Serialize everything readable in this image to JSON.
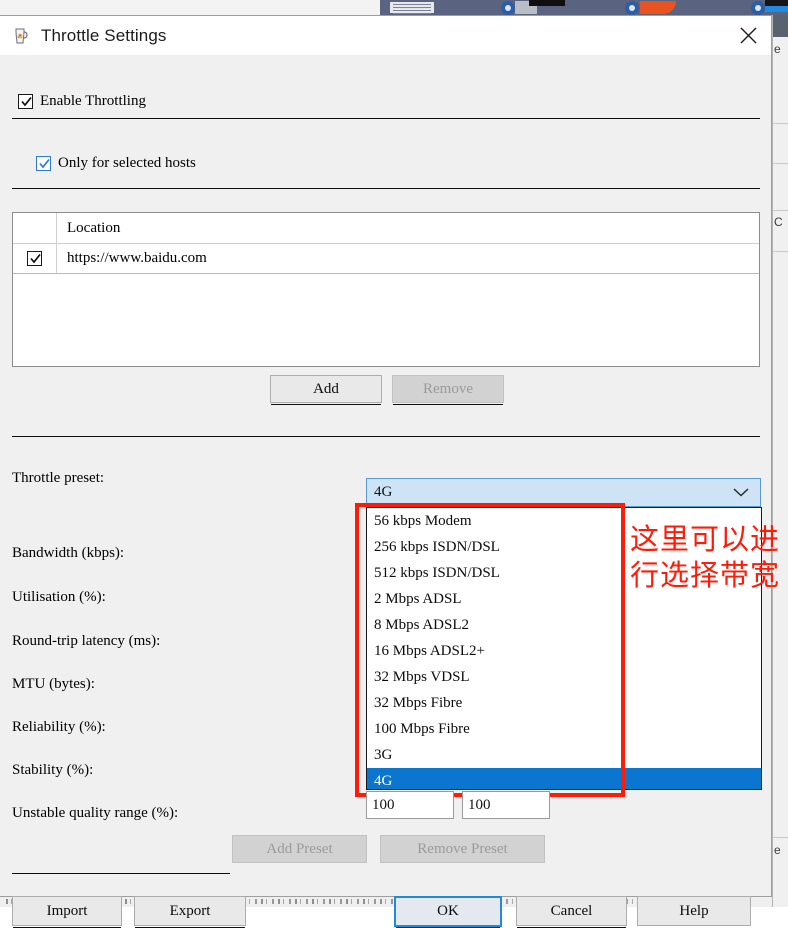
{
  "window": {
    "title": "Throttle Settings",
    "app_icon": "jug-icon",
    "close_label": "✕"
  },
  "options": {
    "enable_throttling": {
      "label": "Enable Throttling",
      "checked": true
    },
    "only_selected_hosts": {
      "label": "Only for selected hosts",
      "checked": true
    }
  },
  "host_table": {
    "column_header": "Location",
    "rows": [
      {
        "checked": true,
        "location": "https://www.baidu.com"
      }
    ],
    "add_label": "Add",
    "remove_label": "Remove",
    "remove_enabled": false
  },
  "fields": {
    "throttle_preset_label": "Throttle preset:",
    "bandwidth_label": "Bandwidth (kbps):",
    "utilisation_label": "Utilisation (%):",
    "latency_label": "Round-trip latency (ms):",
    "mtu_label": "MTU (bytes):",
    "reliability_label": "Reliability (%):",
    "stability_label": "Stability (%):",
    "unstable_range_label": "Unstable quality range (%):",
    "unstable_range_min": "100",
    "unstable_range_max": "100"
  },
  "preset_combo": {
    "selected": "4G",
    "chevron": "chevron-down-icon",
    "expanded": true,
    "options": [
      "56 kbps Modem",
      "256 kbps ISDN/DSL",
      "512 kbps ISDN/DSL",
      "2 Mbps ADSL",
      "8 Mbps ADSL2",
      "16 Mbps ADSL2+",
      "32 Mbps VDSL",
      "32 Mbps Fibre",
      "100 Mbps Fibre",
      "3G",
      "4G"
    ],
    "selected_index": 10
  },
  "preset_buttons": {
    "add_preset_label": "Add Preset",
    "remove_preset_label": "Remove Preset",
    "add_preset_enabled": false,
    "remove_preset_enabled": false
  },
  "footer": {
    "import_label": "Import",
    "export_label": "Export",
    "ok_label": "OK",
    "cancel_label": "Cancel",
    "help_label": "Help"
  },
  "annotation": {
    "text": "这里可以进行选择带宽",
    "color": "#fe1c09"
  },
  "colors": {
    "accent_blue": "#0b76d0",
    "combo_fill": "#cfe3f7",
    "dialog_bg": "#f0f0f0",
    "annotation_red": "#fe1c09",
    "focus_blue": "#1e8bdc"
  },
  "background": {
    "right_panel_glyph_top": "e",
    "right_panel_glyph_mid": "C",
    "right_panel_glyph_bottom": "e"
  }
}
